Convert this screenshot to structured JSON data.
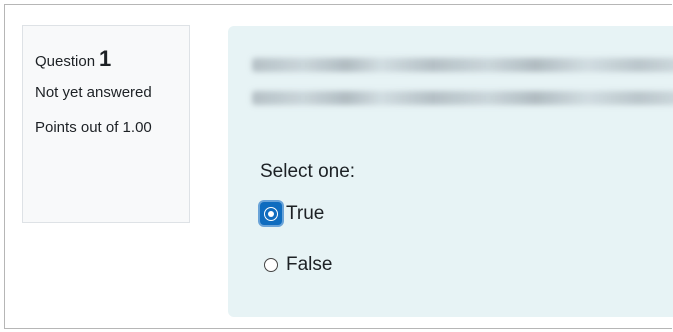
{
  "question_info": {
    "label": "Question",
    "number": "1",
    "state": "Not yet answered",
    "grade": "Points out of 1.00"
  },
  "question": {
    "select_prompt": "Select one:",
    "options": [
      {
        "label": "True",
        "selected": true
      },
      {
        "label": "False",
        "selected": false
      }
    ]
  },
  "colors": {
    "content_background": "#e7f3f5",
    "info_background": "#f8f9fa",
    "accent": "#0f6cbf"
  }
}
